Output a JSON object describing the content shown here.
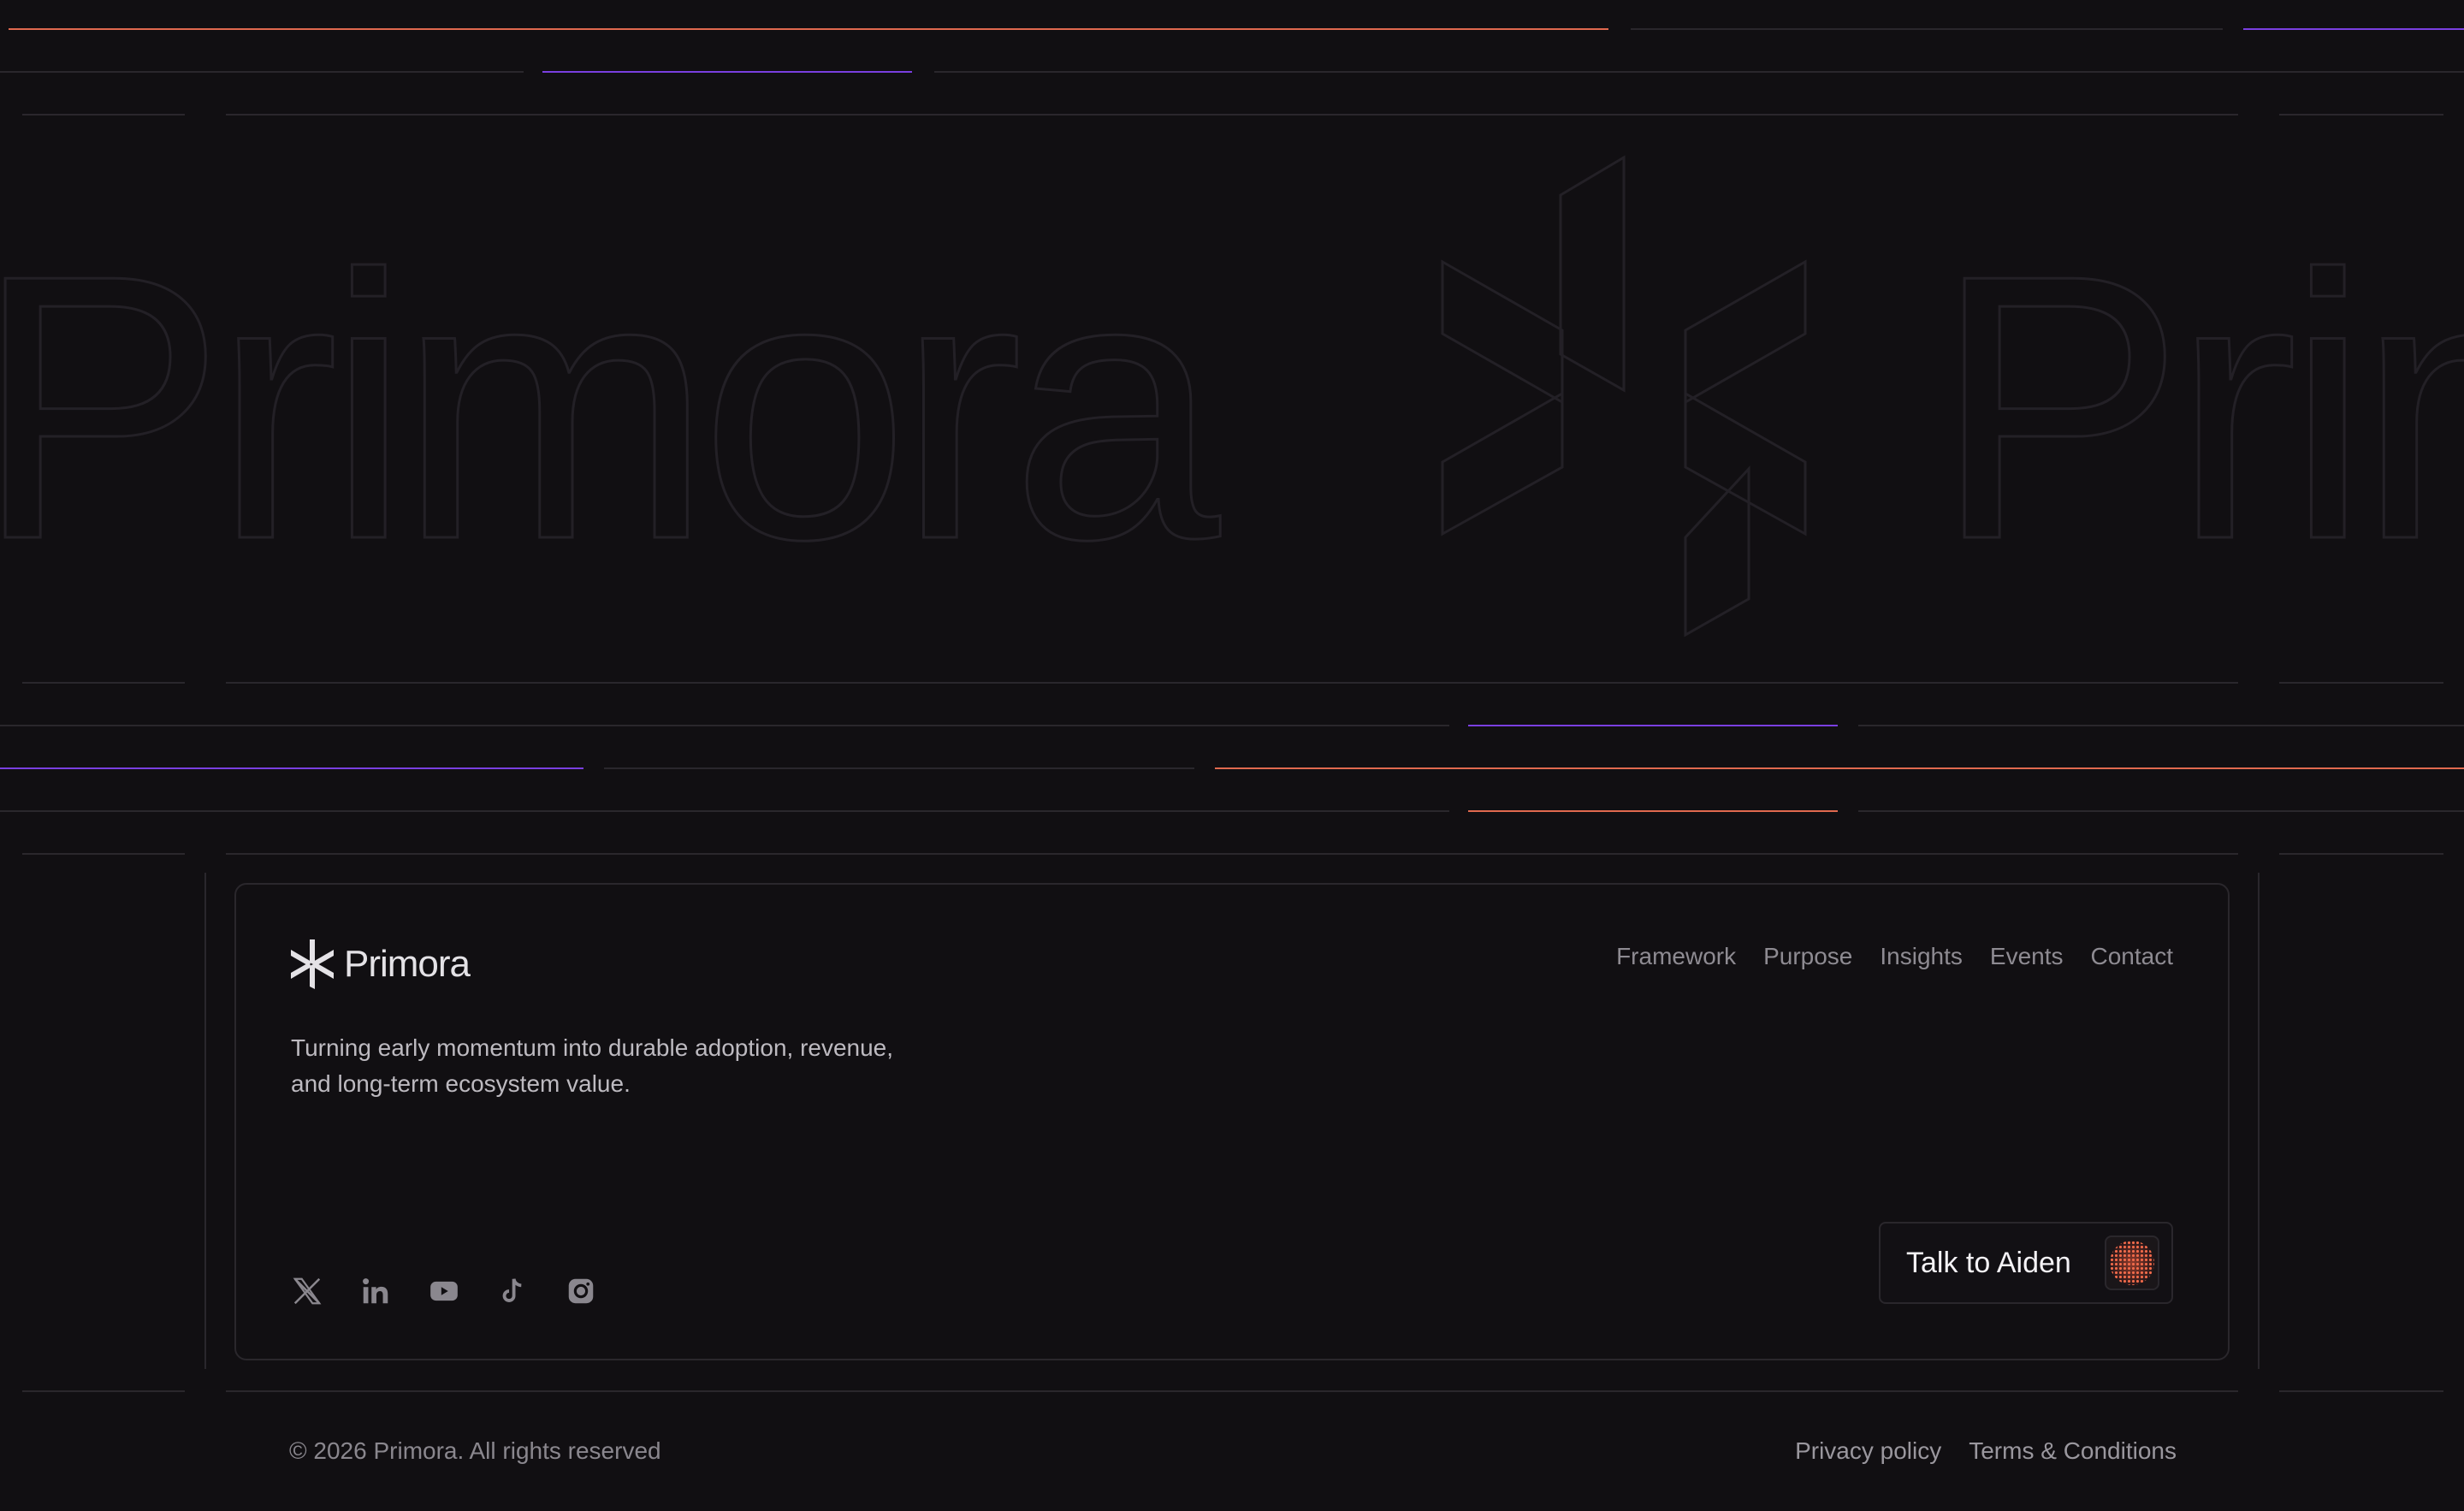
{
  "brand": {
    "name": "Primora",
    "tagline": "Turning early momentum into durable adoption, revenue, and long-term ecosystem value."
  },
  "marquee": {
    "text": "Primora"
  },
  "nav": {
    "items": [
      "Framework",
      "Purpose",
      "Insights",
      "Events",
      "Contact"
    ]
  },
  "socials": [
    "x-icon",
    "linkedin-icon",
    "youtube-icon",
    "tiktok-icon",
    "instagram-icon"
  ],
  "cta": {
    "label": "Talk to Aiden"
  },
  "footer": {
    "copyright": "© 2026 Primora. All rights reserved",
    "privacy": "Privacy policy",
    "terms": "Terms & Conditions"
  },
  "colors": {
    "background": "#110f12",
    "accent_orange": "#e0694f",
    "accent_purple": "#7a3fe0",
    "line": "#2a272c"
  }
}
